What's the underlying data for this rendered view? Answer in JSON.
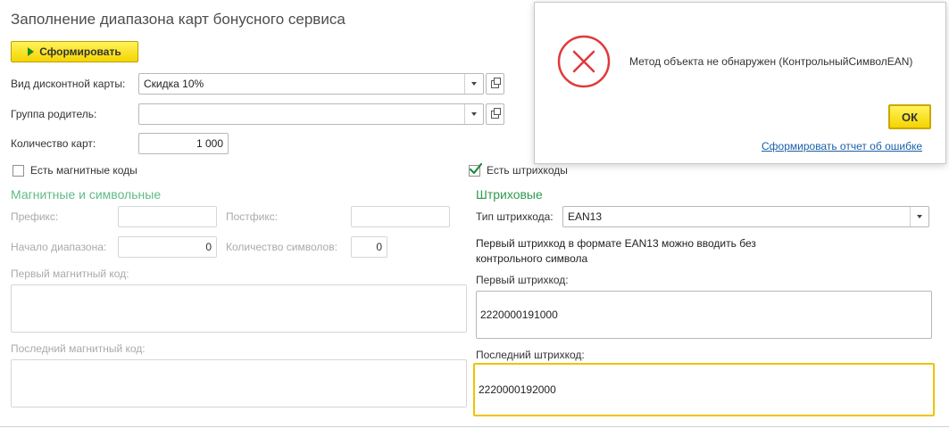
{
  "window": {
    "title": "Заполнение диапазона карт бонусного сервиса"
  },
  "toolbar": {
    "form_label": "Сформировать"
  },
  "card_type": {
    "label": "Вид дисконтной карты:",
    "value": "Скидка 10%"
  },
  "parent_group": {
    "label": "Группа родитель:",
    "value": ""
  },
  "card_count": {
    "label": "Количество карт:",
    "value": "1 000"
  },
  "magnetic": {
    "checkbox_label": "Есть магнитные коды",
    "checked": false,
    "section_title": "Магнитные и символьные",
    "prefix_label": "Префикс:",
    "prefix_value": "",
    "postfix_label": "Постфикс:",
    "postfix_value": "",
    "range_start_label": "Начало диапазона:",
    "range_start_value": "0",
    "symbol_count_label": "Количество символов:",
    "symbol_count_value": "0",
    "first_code_label": "Первый магнитный код:",
    "first_code_value": "",
    "last_code_label": "Последний магнитный код:",
    "last_code_value": ""
  },
  "barcodes": {
    "checkbox_label": "Есть штрихкоды",
    "checked": true,
    "section_title": "Штриховые",
    "type_label": "Тип штрихкода:",
    "type_value": "EAN13",
    "hint": "Первый штрихкод в формате EAN13 можно вводить без контрольного символа",
    "first_label": "Первый штрихкод:",
    "first_value": "2220000191000",
    "last_label": "Последний штрихкод:",
    "last_value": "2220000192000"
  },
  "error_dialog": {
    "message": "Метод объекта не обнаружен (КонтрольныйСимволEAN)",
    "ok_label": "ОК",
    "report_link": "Сформировать отчет об ошибке"
  },
  "colors": {
    "accent_yellow": "#f5d400",
    "section_green": "#2e9b4e",
    "section_green_dim": "#5fba87",
    "error_red": "#e0393b",
    "link_blue": "#1b5fa8"
  }
}
